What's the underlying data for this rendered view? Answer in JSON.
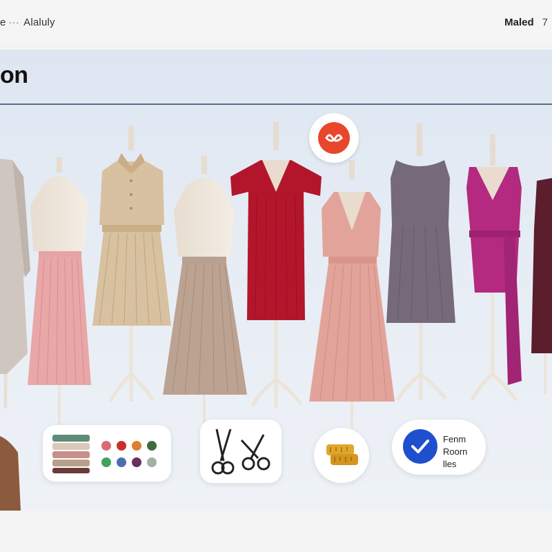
{
  "topbar": {
    "left_text": "e",
    "separator": "···",
    "nav_label": "Alaluly",
    "right_label": "Maled",
    "right_extra": "7"
  },
  "panel": {
    "title": "on"
  },
  "badge": {
    "icon": "brand-logo-icon",
    "color": "#e8472b"
  },
  "cards": {
    "swatches": {
      "icon": "fabric-swatches-icon",
      "fabric_colors": [
        "#5f8b78",
        "#d9c9b8",
        "#c98f8a",
        "#b7a08b",
        "#6b3b3a"
      ],
      "dot_colors": [
        "#d96b74",
        "#c9302c",
        "#e07d2e",
        "#3f6b3c",
        "#3fa35a",
        "#4d6fb0",
        "#6a2f5e",
        "#9fb3a1"
      ]
    },
    "scissors": {
      "icon": "scissors-icon"
    },
    "tape": {
      "icon": "measuring-tape-icon"
    },
    "check": {
      "icon": "checkmark-icon",
      "line1": "Fenm",
      "line2": "Roorn",
      "line3": "lles",
      "accent": "#1f4fcf"
    }
  },
  "mannequins": [
    {
      "name": "grey-long-dress",
      "color": "#cfc6bf"
    },
    {
      "name": "pink-pleated-skirt",
      "color": "#e9a7a8"
    },
    {
      "name": "beige-shirt-dress",
      "color": "#d8c1a0"
    },
    {
      "name": "taupe-pleated-skirt",
      "color": "#bba291"
    },
    {
      "name": "red-knit-dress",
      "color": "#b3162b"
    },
    {
      "name": "blush-wrap-dress",
      "color": "#e2a49a"
    },
    {
      "name": "grey-sleeveless-dress",
      "color": "#75697a"
    },
    {
      "name": "magenta-wrap-dress",
      "color": "#b32a80"
    },
    {
      "name": "maroon-dress",
      "color": "#5a1e2c"
    }
  ]
}
